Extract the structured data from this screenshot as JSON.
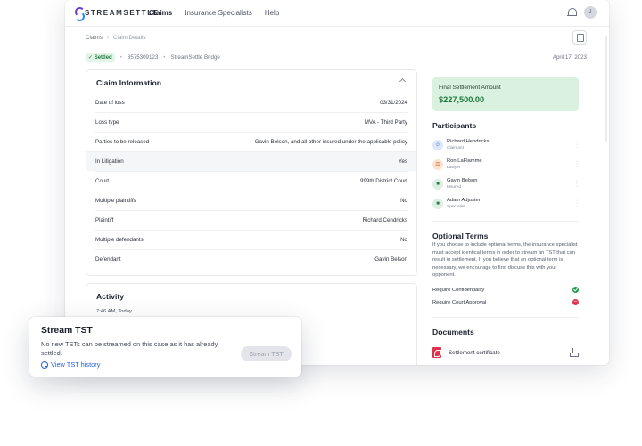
{
  "app": {
    "logo_text": "STREAMSETTLE"
  },
  "nav": {
    "items": [
      "Claims",
      "Insurance Specialists",
      "Help"
    ]
  },
  "header": {
    "avatar_initial": "J"
  },
  "breadcrumb": {
    "root": "Claims",
    "current": "Claim Details"
  },
  "claim": {
    "status": "✓ Settled",
    "number": "8575309123",
    "company": "StreamSettle Bridge",
    "date": "April 17, 2023"
  },
  "claim_info": {
    "title": "Claim Information",
    "rows": [
      {
        "label": "Date of loss",
        "value": "03/31/2024"
      },
      {
        "label": "Loss type",
        "value": "MVA - Third Party"
      },
      {
        "label": "Parties to be released",
        "value": "Gavin Belson, and all other insured under the applicable policy"
      },
      {
        "label": "In Litigation",
        "value": "Yes"
      },
      {
        "label": "Court",
        "value": "999th District Court"
      },
      {
        "label": "Multiple plaintiffs",
        "value": "No"
      },
      {
        "label": "Plaintiff",
        "value": "Richard Cendricks"
      },
      {
        "label": "Multiple defendants",
        "value": "No"
      },
      {
        "label": "Defendant",
        "value": "Gavin Belson"
      }
    ]
  },
  "activity": {
    "title": "Activity",
    "time": "7:46 AM, Today"
  },
  "settlement": {
    "label": "Final Settlement Amount",
    "amount": "$227,500.00",
    "color": "#1a7a3a"
  },
  "participants": {
    "title": "Participants",
    "items": [
      {
        "name": "Richard Hendricks",
        "role": "Claimant"
      },
      {
        "name": "Ron LaFlamme",
        "role": "Lawyer"
      },
      {
        "name": "Gavin Belson",
        "role": "Insured"
      },
      {
        "name": "Adam Adjuster",
        "role": "Specialist"
      }
    ]
  },
  "optional_terms": {
    "title": "Optional Terms",
    "description": "If you choose to include optional terms, the insurance specialist must accept identical terms in order to stream an TST that can result in settlement. If you believe that an optional term is necessary, we encourage to first discuss this with your opponent.",
    "items": [
      {
        "label": "Require Confidentiality",
        "state": "yes",
        "icon": "check-icon"
      },
      {
        "label": "Require Court Approval",
        "state": "no",
        "icon": "minus-icon"
      }
    ]
  },
  "documents": {
    "title": "Documents",
    "items": [
      {
        "name": "Settlement certificate"
      }
    ]
  },
  "popup": {
    "title": "Stream TST",
    "message": "No new TSTs can be streamed on this case as it has already settled.",
    "link": "View TST history",
    "button": "Stream TST"
  }
}
